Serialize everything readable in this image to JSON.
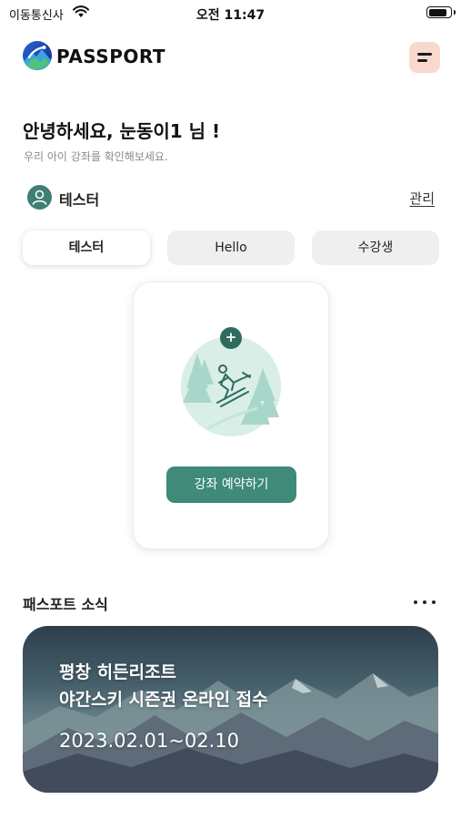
{
  "status_bar": {
    "carrier": "이동통신사",
    "time": "오전 11:47",
    "battery_level": 0.85
  },
  "header": {
    "logo_text": "PASSPORT",
    "menu_icon": "hamburger-menu-icon",
    "menu_button_color": "#f8d9cc"
  },
  "greeting": {
    "title": "안녕하세요, 눈동이1 님 !",
    "subtitle": "우리 아이 강좌를 확인해보세요."
  },
  "child": {
    "name": "테스터",
    "manage_label": "관리",
    "avatar_icon": "person-icon",
    "avatar_color": "#3f7f74"
  },
  "tabs": [
    {
      "label": "테스터",
      "active": true
    },
    {
      "label": "Hello",
      "active": false
    },
    {
      "label": "수강생",
      "active": false
    }
  ],
  "booking_card": {
    "add_icon_glyph": "+",
    "illustration": "skier-icon",
    "button_label": "강좌 예약하기",
    "accent_color": "#3f8a78"
  },
  "news": {
    "title": "패스포트 소식",
    "more_icon": "more-dots-icon",
    "banner": {
      "line1": "평창 히든리조트",
      "line2": "야간스키 시즌권 온라인 접수",
      "date": "2023.02.01~02.10"
    }
  }
}
